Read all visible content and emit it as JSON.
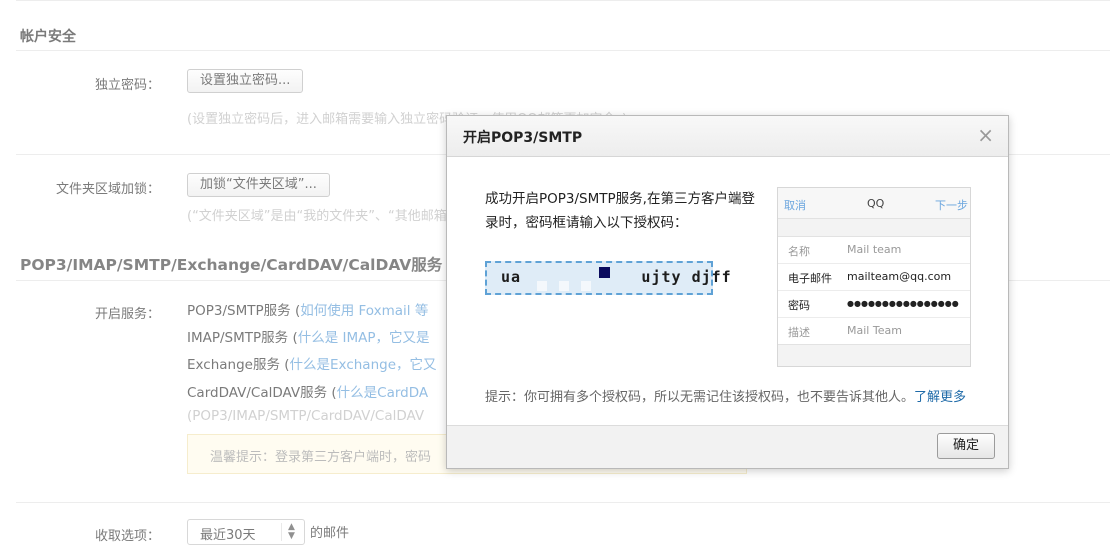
{
  "account_security": {
    "title": "帐户安全",
    "independent_password": {
      "label": "独立密码：",
      "button": "设置独立密码...",
      "hint": "(设置独立密码后，进入邮箱需要输入独立密码验证，使用QQ邮箱更加安全。)"
    },
    "folder_lock": {
      "label": "文件夹区域加锁：",
      "button": "加锁“文件夹区域”...",
      "hint": "(“文件夹区域”是由“我的文件夹”、“其他邮箱”组成)"
    }
  },
  "services": {
    "title": "POP3/IMAP/SMTP/Exchange/CardDAV/CalDAV服务",
    "label": "开启服务：",
    "items": [
      {
        "name": "POP3/SMTP服务 (",
        "link": "如何使用 Foxmail 等"
      },
      {
        "name": "IMAP/SMTP服务 (",
        "link": "什么是 IMAP，它又是"
      },
      {
        "name": "Exchange服务 (",
        "link": "什么是Exchange，它又"
      },
      {
        "name": "CardDAV/CalDAV服务 (",
        "link": "什么是CardDA"
      }
    ],
    "note": "(POP3/IMAP/SMTP/CardDAV/CalDAV",
    "warm_tip": "温馨提示：登录第三方客户端时，密码"
  },
  "receive_options": {
    "label": "收取选项：",
    "select_value": "最近30天",
    "suffix": "的邮件"
  },
  "dialog": {
    "title": "开启POP3/SMTP",
    "close": "×",
    "message": "成功开启POP3/SMTP服务,在第三方客户端登录时，密码框请输入以下授权码：",
    "auth_code": "ua            ujty djff",
    "phone": {
      "cancel": "取消",
      "center": "QQ",
      "next": "下一步",
      "rows": [
        {
          "key": "名称",
          "value": "Mail team"
        },
        {
          "key": "电子邮件",
          "value": "mailteam@qq.com"
        },
        {
          "key": "密码",
          "value": "●●●●●●●●●●●●●●●●"
        },
        {
          "key": "描述",
          "value": "Mail Team"
        }
      ]
    },
    "tip": "提示：你可拥有多个授权码，所以无需记住该授权码，也不要告诉其他人。",
    "tip_link": "了解更多",
    "ok": "确定"
  }
}
